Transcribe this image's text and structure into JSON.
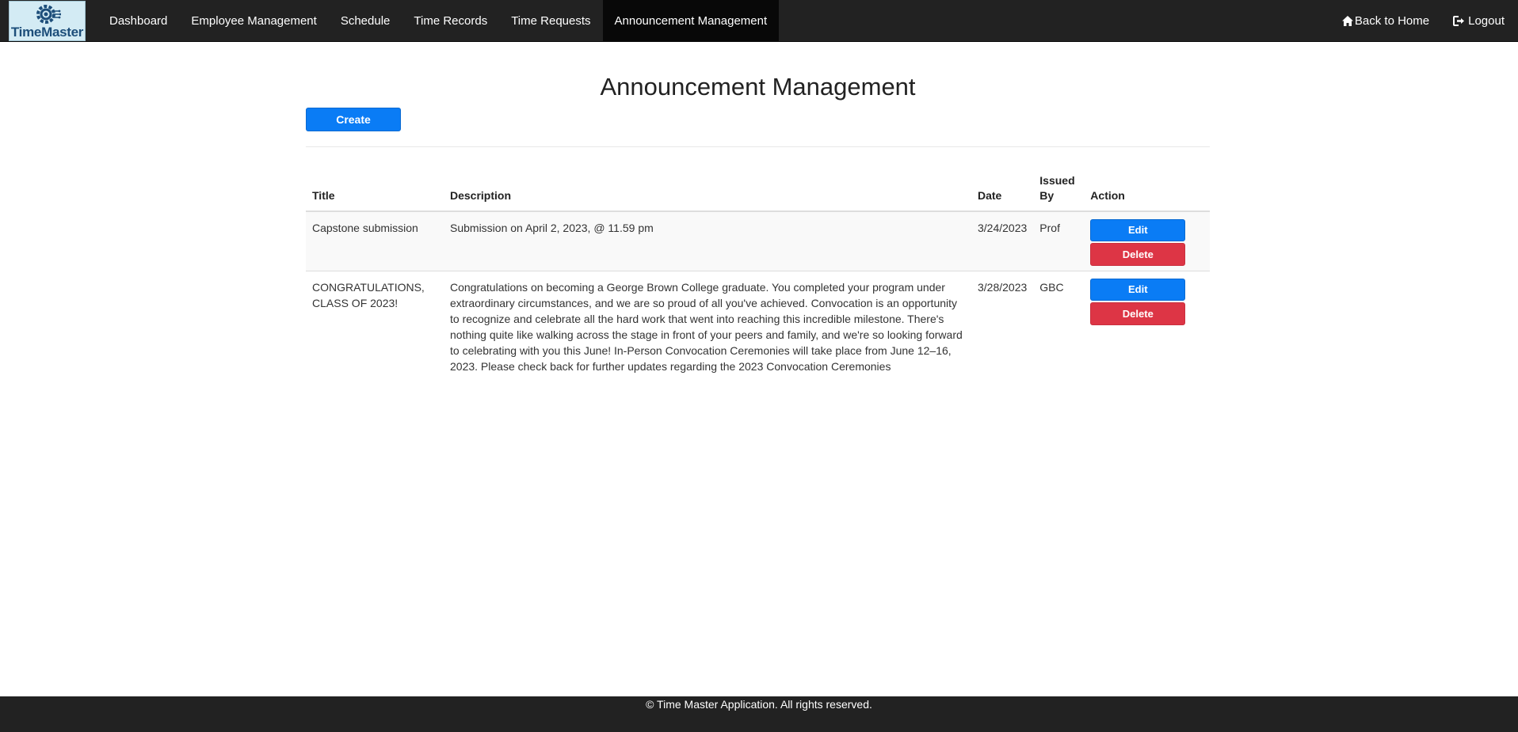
{
  "nav": {
    "logo_text": "TimeMaster",
    "items": [
      {
        "label": "Dashboard"
      },
      {
        "label": "Employee Management"
      },
      {
        "label": "Schedule"
      },
      {
        "label": "Time Records"
      },
      {
        "label": "Time Requests"
      },
      {
        "label": "Announcement Management",
        "active": true
      }
    ],
    "right": {
      "home_label": "Back to Home",
      "home_icon": "home-icon",
      "logout_label": "Logout",
      "logout_icon": "logout-icon"
    }
  },
  "page": {
    "title": "Announcement Management",
    "create_label": "Create"
  },
  "table": {
    "headers": {
      "title": "Title",
      "description": "Description",
      "date": "Date",
      "issued_by": "Issued By",
      "action": "Action"
    },
    "rows": [
      {
        "title": "Capstone submission",
        "description": "Submission on April 2, 2023, @ 11.59 pm",
        "date": "3/24/2023",
        "issued_by": "Prof",
        "edit_label": "Edit",
        "delete_label": "Delete"
      },
      {
        "title": "CONGRATULATIONS, CLASS OF 2023!",
        "description": "Congratulations on becoming a George Brown College graduate. You completed your program under extraordinary circumstances, and we are so proud of all you've achieved. Convocation is an opportunity to recognize and celebrate all the hard work that went into reaching this incredible milestone. There's nothing quite like walking across the stage in front of your peers and family, and we're so looking forward to celebrating with you this June! In-Person Convocation Ceremonies will take place from June 12–16, 2023. Please check back for further updates regarding the 2023 Convocation Ceremonies",
        "date": "3/28/2023",
        "issued_by": "GBC",
        "edit_label": "Edit",
        "delete_label": "Delete"
      }
    ]
  },
  "footer": {
    "text": "© Time Master Application. All rights reserved."
  },
  "colors": {
    "navbar": "#222222",
    "primary": "#0a7cf5",
    "danger": "#dd3545"
  }
}
